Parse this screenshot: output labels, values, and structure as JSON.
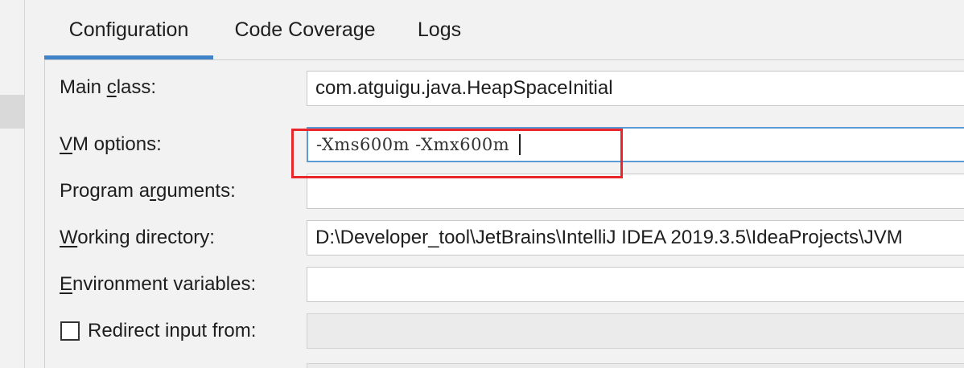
{
  "tabs": [
    {
      "label": "Configuration",
      "active": true
    },
    {
      "label": "Code Coverage",
      "active": false
    },
    {
      "label": "Logs",
      "active": false
    }
  ],
  "form": {
    "main_class": {
      "label_pre": "Main ",
      "label_mnemonic": "c",
      "label_post": "lass:",
      "value": "com.atguigu.java.HeapSpaceInitial"
    },
    "vm_options": {
      "label_mnemonic": "V",
      "label_post": "M options:",
      "value": "-Xms600m -Xmx600m"
    },
    "program_arguments": {
      "label_pre": "Program a",
      "label_mnemonic": "r",
      "label_post": "guments:",
      "value": ""
    },
    "working_directory": {
      "label_mnemonic": "W",
      "label_post": "orking directory:",
      "value": "D:\\Developer_tool\\JetBrains\\IntelliJ IDEA 2019.3.5\\IdeaProjects\\JVM"
    },
    "environment_variables": {
      "label_mnemonic": "E",
      "label_post": "nvironment variables:",
      "value": ""
    },
    "redirect_input": {
      "label": "Redirect input from:",
      "checked": false,
      "value": ""
    }
  },
  "colors": {
    "tab_underline": "#4083c9",
    "annotation_box": "#e8262c",
    "focus_border": "#5b9bd5"
  }
}
